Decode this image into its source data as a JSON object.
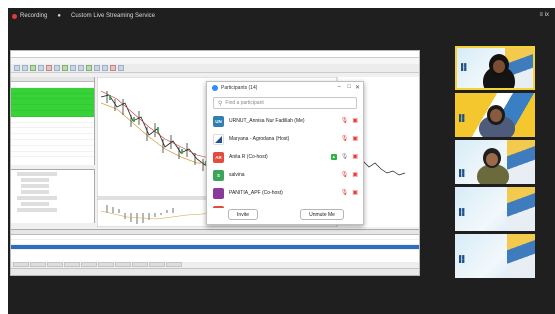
{
  "zoom": {
    "recording_label": "Recording",
    "window_title": "Custom Live Streaming Service",
    "corner_text": "≡ ix"
  },
  "participants_panel": {
    "title": "Participants (14)",
    "search_placeholder": "Find a participant",
    "participants": [
      {
        "initials": "UN",
        "avatar_color": "#2f7fb4",
        "name": "URNUT_Annisa Nur Fadillah (Me)",
        "icons": [
          "mic-muted-icon",
          "video-off-icon"
        ]
      },
      {
        "initials": "",
        "avatar_color": "#ffffff",
        "name": "Maryana - Agrodana (Host)",
        "icons": [
          "mic-muted-icon",
          "video-off-icon"
        ]
      },
      {
        "initials": "AR",
        "avatar_color": "#e34b3c",
        "name": "Anita R (Co-host)",
        "icons": [
          "share-screen-icon",
          "mic-icon",
          "video-off-icon"
        ]
      },
      {
        "initials": "S",
        "avatar_color": "#3aa65b",
        "name": "salvina",
        "icons": [
          "mic-muted-icon",
          "video-off-icon"
        ]
      },
      {
        "initials": "",
        "avatar_color": "#8a3a9c",
        "name": "PANITIA_APF (Co-host)",
        "icons": [
          "mic-muted-icon",
          "video-off-icon"
        ]
      },
      {
        "initials": "",
        "avatar_color": "#e34b3c",
        "name": "",
        "icons": []
      }
    ],
    "buttons": {
      "left": "Invite",
      "right": "Unmute Me"
    }
  }
}
